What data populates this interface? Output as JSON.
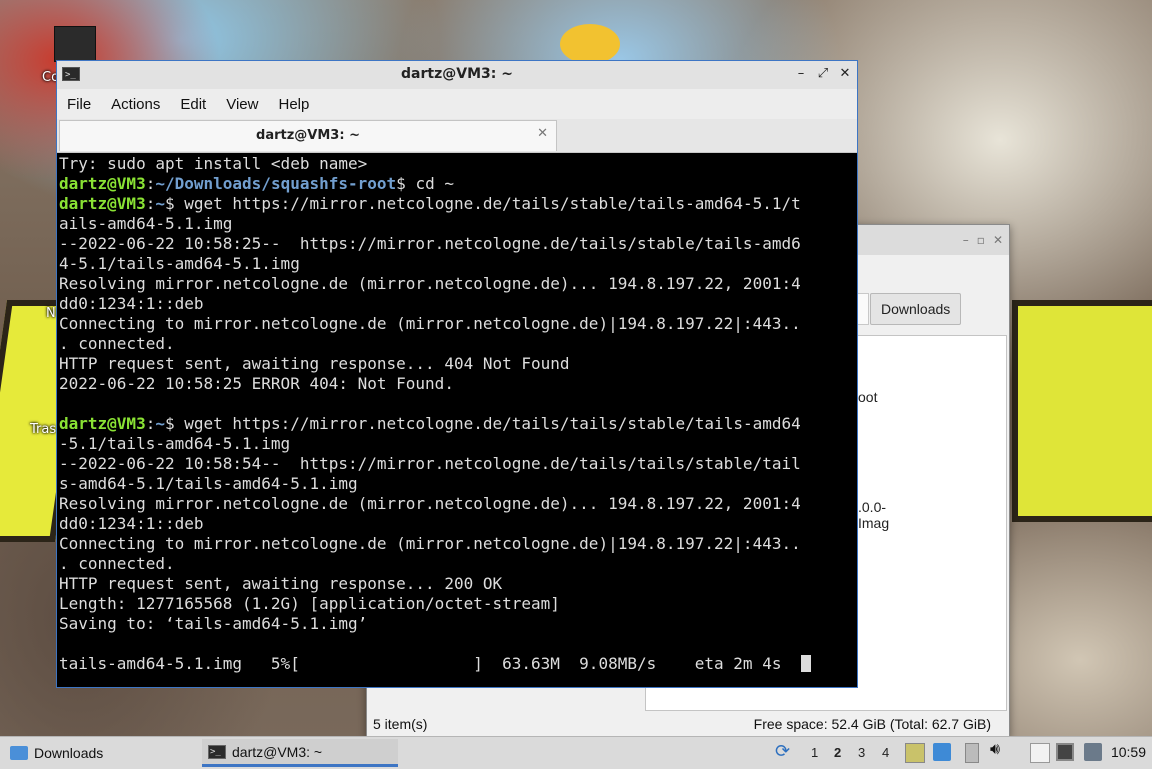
{
  "desktop": {
    "icon_labels": [
      "Co",
      "N",
      "Tras"
    ]
  },
  "file_manager": {
    "path_button": "Downloads",
    "fragments": [
      "oot",
      ".0.0-",
      "Imag"
    ],
    "status_left": "5 item(s)",
    "status_right": "Free space: 52.4 GiB (Total: 62.7 GiB)"
  },
  "terminal": {
    "title": "dartz@VM3: ~",
    "menu": [
      "File",
      "Actions",
      "Edit",
      "View",
      "Help"
    ],
    "tab_label": "dartz@VM3: ~",
    "lines": [
      {
        "text": "Try: sudo apt install <deb name>"
      },
      {
        "user": "dartz@VM3",
        "path": "~/Downloads/squashfs-root",
        "cmd": "$ cd ~"
      },
      {
        "user": "dartz@VM3",
        "path": "~",
        "cmd": "$ wget https://mirror.netcologne.de/tails/stable/tails-amd64-5.1/t"
      },
      {
        "text": "ails-amd64-5.1.img"
      },
      {
        "text": "--2022-06-22 10:58:25--  https://mirror.netcologne.de/tails/stable/tails-amd6"
      },
      {
        "text": "4-5.1/tails-amd64-5.1.img"
      },
      {
        "text": "Resolving mirror.netcologne.de (mirror.netcologne.de)... 194.8.197.22, 2001:4"
      },
      {
        "text": "dd0:1234:1::deb"
      },
      {
        "text": "Connecting to mirror.netcologne.de (mirror.netcologne.de)|194.8.197.22|:443.."
      },
      {
        "text": ". connected."
      },
      {
        "text": "HTTP request sent, awaiting response... 404 Not Found"
      },
      {
        "text": "2022-06-22 10:58:25 ERROR 404: Not Found."
      },
      {
        "text": ""
      },
      {
        "user": "dartz@VM3",
        "path": "~",
        "cmd": "$ wget https://mirror.netcologne.de/tails/tails/stable/tails-amd64"
      },
      {
        "text": "-5.1/tails-amd64-5.1.img"
      },
      {
        "text": "--2022-06-22 10:58:54--  https://mirror.netcologne.de/tails/tails/stable/tail"
      },
      {
        "text": "s-amd64-5.1/tails-amd64-5.1.img"
      },
      {
        "text": "Resolving mirror.netcologne.de (mirror.netcologne.de)... 194.8.197.22, 2001:4"
      },
      {
        "text": "dd0:1234:1::deb"
      },
      {
        "text": "Connecting to mirror.netcologne.de (mirror.netcologne.de)|194.8.197.22|:443.."
      },
      {
        "text": ". connected."
      },
      {
        "text": "HTTP request sent, awaiting response... 200 OK"
      },
      {
        "text": "Length: 1277165568 (1.2G) [application/octet-stream]"
      },
      {
        "text": "Saving to: ‘tails-amd64-5.1.img’"
      },
      {
        "text": ""
      },
      {
        "text": "tails-amd64-5.1.img   5%[                  ]  63.63M  9.08MB/s    eta 2m 4s  ",
        "cursor": true
      }
    ]
  },
  "taskbar": {
    "tasks": [
      {
        "label": "Downloads",
        "icon": "folder-icon"
      },
      {
        "label": "dartz@VM3: ~",
        "icon": "terminal-icon"
      }
    ],
    "workspaces": [
      "1",
      "2",
      "3",
      "4"
    ],
    "active_workspace": "2",
    "clock": "10:59"
  },
  "colors": {
    "accent": "#3d75c4",
    "prompt_user": "#8ae234",
    "prompt_path": "#729fcf",
    "terminal_bg": "#000000",
    "terminal_fg": "#dddddd"
  }
}
